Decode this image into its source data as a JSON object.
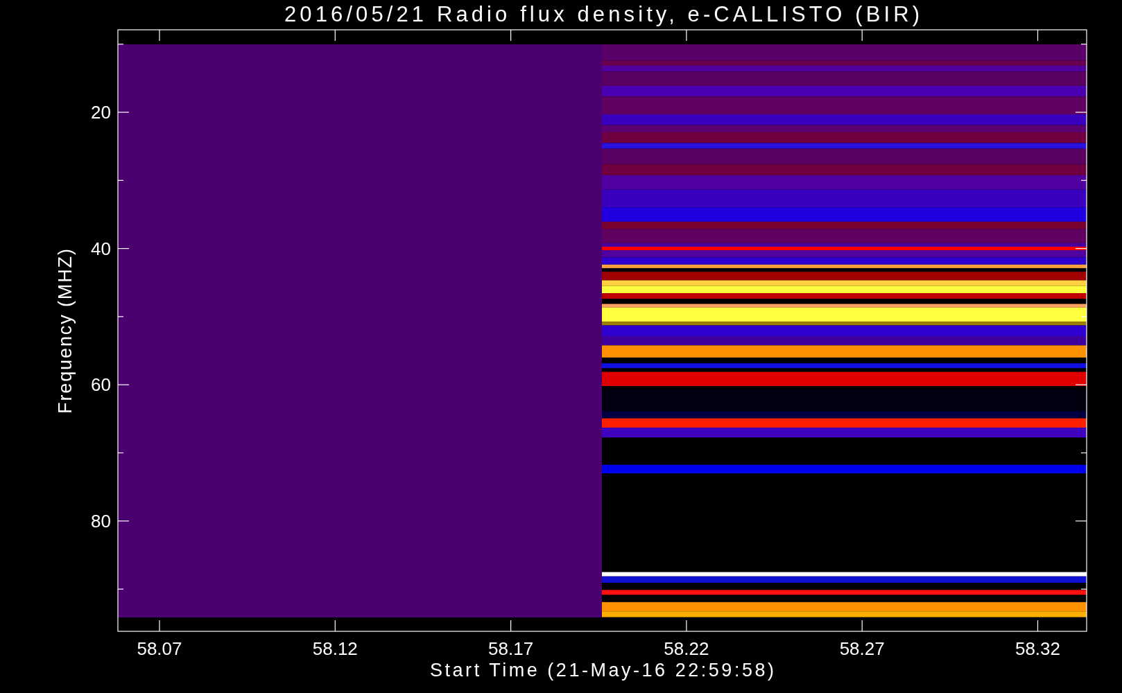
{
  "title": "2016/05/21  Radio flux density, e-CALLISTO (BIR)",
  "plot": {
    "x_axis": {
      "label": "Start Time (21-May-16 22:59:58)",
      "ticks": [
        "58.07",
        "58.12",
        "58.17",
        "58.22",
        "58.27",
        "58.32"
      ]
    },
    "y_axis": {
      "label": "Frequency (MHZ)",
      "ticks": [
        "20",
        "40",
        "60",
        "80"
      ]
    }
  }
}
